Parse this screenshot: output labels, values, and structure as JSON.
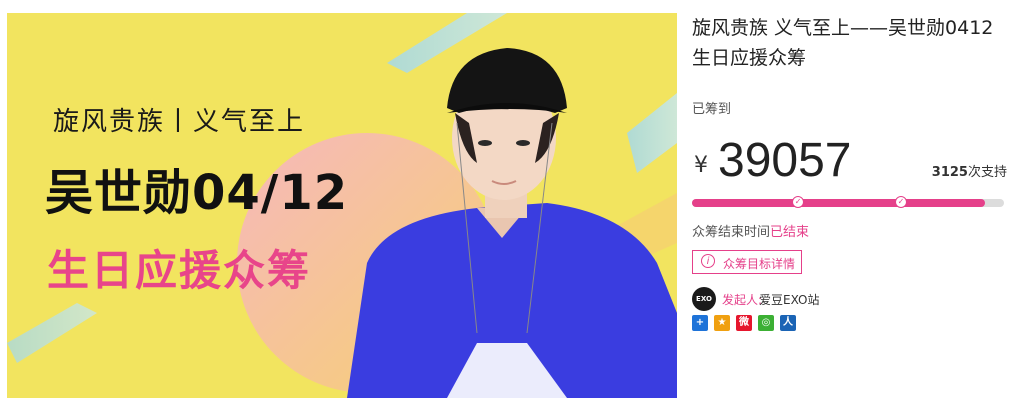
{
  "banner": {
    "line1": "旋风贵族丨义气至上",
    "line2": "吴世勋04/12",
    "line3": "生日应援众筹"
  },
  "project": {
    "title": "旋风贵族 义气至上——吴世勋0412生日应援众筹",
    "raised_label": "已筹到",
    "currency": "¥",
    "amount": "39057",
    "supporters_count": "3125",
    "supporters_suffix": "次支持",
    "progress": 0.94,
    "milestones": [
      0.34,
      0.67
    ],
    "end_label": "众筹结束时间",
    "end_status": "已结束",
    "target_button": "众筹目标详情"
  },
  "initiator": {
    "label": "发起人:",
    "name": "爱豆EXO站",
    "avatar_text": "EXO"
  },
  "share_icons": [
    {
      "name": "qzone-plus-icon",
      "glyph": "+",
      "color": "#1e73d8"
    },
    {
      "name": "qq-space-icon",
      "glyph": "★",
      "color": "#f0a010"
    },
    {
      "name": "weibo-icon",
      "glyph": "微",
      "color": "#e6162d"
    },
    {
      "name": "wechat-icon",
      "glyph": "◎",
      "color": "#3cb034"
    },
    {
      "name": "renren-icon",
      "glyph": "人",
      "color": "#1b64b5"
    }
  ],
  "colors": {
    "accent": "#e5408a",
    "banner_bg": "#f2e45f",
    "shirt": "#3a3de0"
  }
}
